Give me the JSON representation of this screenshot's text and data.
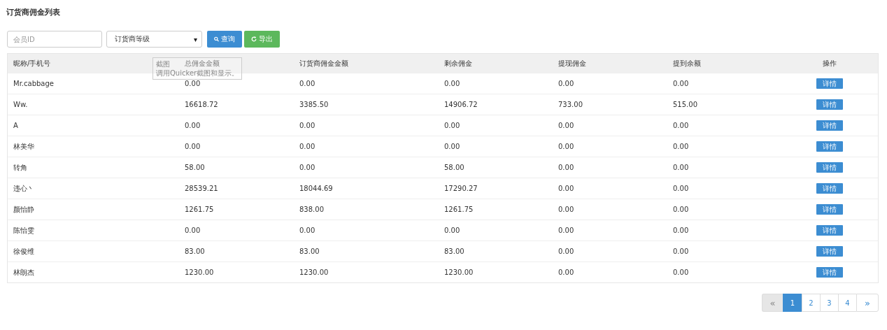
{
  "page_title": "订货商佣金列表",
  "filters": {
    "member_id": {
      "placeholder": "会员ID"
    },
    "level_select": {
      "value": "订货商等级",
      "caret": "▾"
    },
    "buttons": [
      {
        "label": "查询",
        "kind": "search"
      },
      {
        "label": "导出",
        "kind": "export"
      }
    ]
  },
  "table": {
    "columns": [
      "昵称/手机号",
      "总佣金金额",
      "订货商佣金金额",
      "剩余佣金",
      "提现佣金",
      "提到余额",
      "操作"
    ],
    "rows": [
      {
        "cells": [
          "Mr.cabbage",
          "0.00",
          "0.00",
          "0.00",
          "0.00",
          "0.00"
        ],
        "action": "详情"
      },
      {
        "cells": [
          "Ww.",
          "16618.72",
          "3385.50",
          "14906.72",
          "733.00",
          "515.00"
        ],
        "action": "详情"
      },
      {
        "cells": [
          "A",
          "0.00",
          "0.00",
          "0.00",
          "0.00",
          "0.00"
        ],
        "action": "详情"
      },
      {
        "cells": [
          "林美华",
          "0.00",
          "0.00",
          "0.00",
          "0.00",
          "0.00"
        ],
        "action": "详情"
      },
      {
        "cells": [
          "转角",
          "58.00",
          "0.00",
          "58.00",
          "0.00",
          "0.00"
        ],
        "action": "详情"
      },
      {
        "cells": [
          "违心丶",
          "28539.21",
          "18044.69",
          "17290.27",
          "0.00",
          "0.00"
        ],
        "action": "详情"
      },
      {
        "cells": [
          "颜怡静",
          "1261.75",
          "838.00",
          "1261.75",
          "0.00",
          "0.00"
        ],
        "action": "详情"
      },
      {
        "cells": [
          "陈怡雯",
          "0.00",
          "0.00",
          "0.00",
          "0.00",
          "0.00"
        ],
        "action": "详情"
      },
      {
        "cells": [
          "徐俊维",
          "83.00",
          "83.00",
          "83.00",
          "0.00",
          "0.00"
        ],
        "action": "详情"
      },
      {
        "cells": [
          "林朗杰",
          "1230.00",
          "1230.00",
          "1230.00",
          "0.00",
          "0.00"
        ],
        "action": "详情"
      }
    ]
  },
  "tooltip": {
    "title": "截图",
    "text": "调用Quicker截图和显示。"
  },
  "pagination": {
    "prev": {
      "label": "«",
      "disabled": true
    },
    "pages": [
      {
        "label": "1",
        "selected": true
      },
      {
        "label": "2",
        "selected": false
      },
      {
        "label": "3",
        "selected": false
      },
      {
        "label": "4",
        "selected": false
      }
    ],
    "next": {
      "label": "»",
      "disabled": false
    }
  }
}
